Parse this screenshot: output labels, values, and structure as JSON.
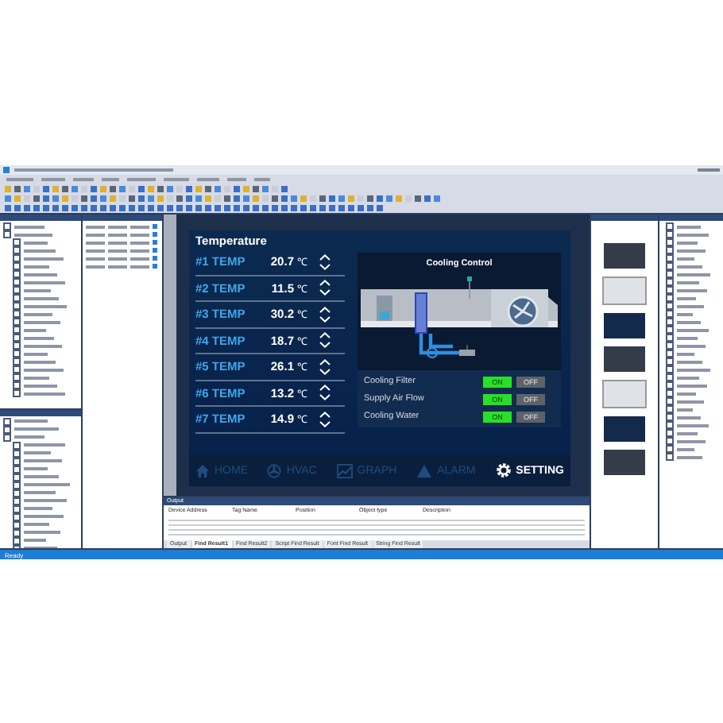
{
  "screen": {
    "title": "Temperature",
    "temps": [
      {
        "label": "#1 TEMP",
        "value": "20.7",
        "unit": "℃"
      },
      {
        "label": "#2 TEMP",
        "value": "11.5",
        "unit": "℃"
      },
      {
        "label": "#3 TEMP",
        "value": "30.2",
        "unit": "℃"
      },
      {
        "label": "#4 TEMP",
        "value": "18.7",
        "unit": "℃"
      },
      {
        "label": "#5 TEMP",
        "value": "26.1",
        "unit": "℃"
      },
      {
        "label": "#6 TEMP",
        "value": "13.2",
        "unit": "℃"
      },
      {
        "label": "#7 TEMP",
        "value": "14.9",
        "unit": "℃"
      }
    ],
    "cooling": {
      "title": "Cooling Control",
      "controls": [
        {
          "label": "Cooling Filter",
          "on_label": "ON",
          "off_label": "OFF",
          "on": true
        },
        {
          "label": "Supply Air Flow",
          "on_label": "ON",
          "off_label": "OFF",
          "on": true
        },
        {
          "label": "Cooling Water",
          "on_label": "ON",
          "off_label": "OFF",
          "on": true
        }
      ]
    },
    "nav": [
      {
        "label": "HOME",
        "kind": "home",
        "selected": false
      },
      {
        "label": "HVAC",
        "kind": "hvac",
        "selected": false
      },
      {
        "label": "GRAPH",
        "kind": "graph",
        "selected": false
      },
      {
        "label": "ALARM",
        "kind": "alarm",
        "selected": false
      },
      {
        "label": "SETTING",
        "kind": "setting",
        "selected": true
      }
    ]
  },
  "output": {
    "title": "Output",
    "columns": [
      "Device Address",
      "Tag Name",
      "Position",
      "Object type",
      "Description"
    ],
    "tabs": [
      {
        "label": "Output",
        "selected": false
      },
      {
        "label": "Find Result1",
        "selected": true
      },
      {
        "label": "Find Result2",
        "selected": false
      },
      {
        "label": "Script Find Result",
        "selected": false
      },
      {
        "label": "Font Find Result",
        "selected": false
      },
      {
        "label": "String Find Result",
        "selected": false
      }
    ]
  },
  "status_bar": {
    "text": "Ready"
  }
}
